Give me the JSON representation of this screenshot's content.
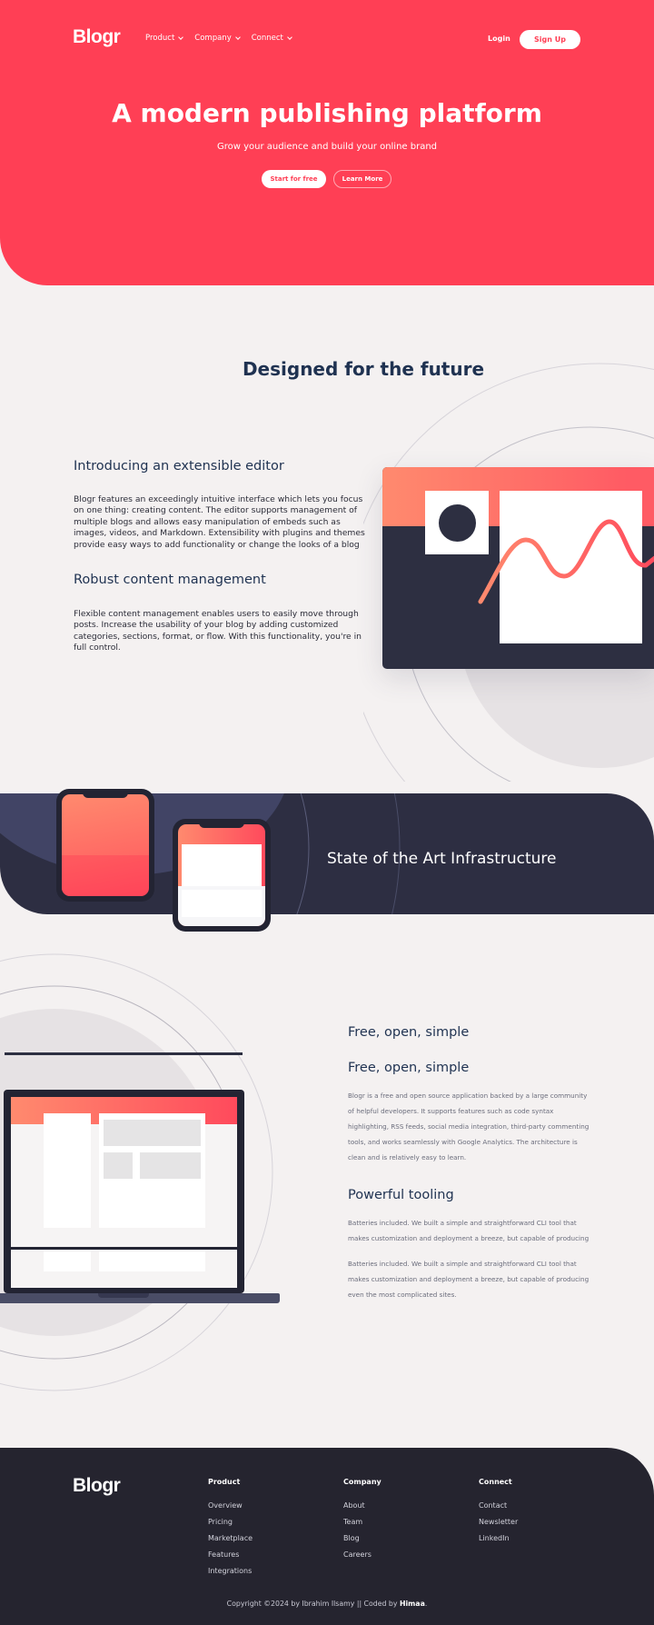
{
  "header": {
    "logo": "Blogr",
    "nav": [
      {
        "label": "Product",
        "icon": "chevron-down-icon"
      },
      {
        "label": "Company",
        "icon": "chevron-down-icon"
      },
      {
        "label": "Connect",
        "icon": "chevron-down-icon"
      }
    ],
    "login_label": "Login",
    "signup_label": "Sign Up"
  },
  "hero": {
    "title": "A modern publishing platform",
    "subtitle": "Grow your audience and build your online brand",
    "primary_button": "Start for free",
    "secondary_button": "Learn More"
  },
  "features": {
    "title": "Designed for the future",
    "items": [
      {
        "heading": "Introducing an extensible editor",
        "body": "Blogr features an exceedingly intuitive interface which lets you focus on one thing: creating content. The editor supports management of multiple blogs and allows easy manipulation of embeds such as images, videos, and Markdown. Extensibility with plugins and themes provide easy ways to add functionality or change the looks of a blog"
      },
      {
        "heading": "Robust content management",
        "body": "Flexible content management enables users to easily move through posts. Increase the usability of your blog by adding customized categories, sections, format, or flow. With this functionality, you're in full control."
      }
    ]
  },
  "infrastructure": {
    "title": "State of the Art Infrastructure"
  },
  "tools": {
    "items": [
      {
        "heading": "Free, open, simple",
        "body": ""
      },
      {
        "heading": "Free, open, simple",
        "body": "Blogr is a free and open source application backed by a large community of helpful developers. It supports features such as code syntax highlighting, RSS feeds, social media integration, third-party commenting tools, and works seamlessly with Google Analytics. The architecture is clean and is relatively easy to learn."
      },
      {
        "heading": "Powerful tooling",
        "body": "Batteries included. We built a simple and straightforward CLI tool that makes customization and deployment a breeze, but capable of producing",
        "body2": "Batteries included. We built a simple and straightforward CLI tool that makes customization and deployment a breeze, but capable of producing even the most complicated sites."
      }
    ]
  },
  "footer": {
    "logo": "Blogr",
    "columns": [
      {
        "heading": "Product",
        "links": [
          "Overview",
          "Pricing",
          "Marketplace",
          "Features",
          "Integrations"
        ]
      },
      {
        "heading": "Company",
        "links": [
          "About",
          "Team",
          "Blog",
          "Careers"
        ]
      },
      {
        "heading": "Connect",
        "links": [
          "Contact",
          "Newsletter",
          "LinkedIn"
        ]
      }
    ],
    "copyright_prefix": "Copyright ©2024 by Ibrahim Ilsamy || Coded by ",
    "copyright_author": "Himaa",
    "copyright_suffix": "."
  },
  "colors": {
    "brand": "#ff3f55",
    "dark": "#2d2e42",
    "footer": "#25242f",
    "heading": "#1f3251",
    "background": "#f4f1f1"
  }
}
